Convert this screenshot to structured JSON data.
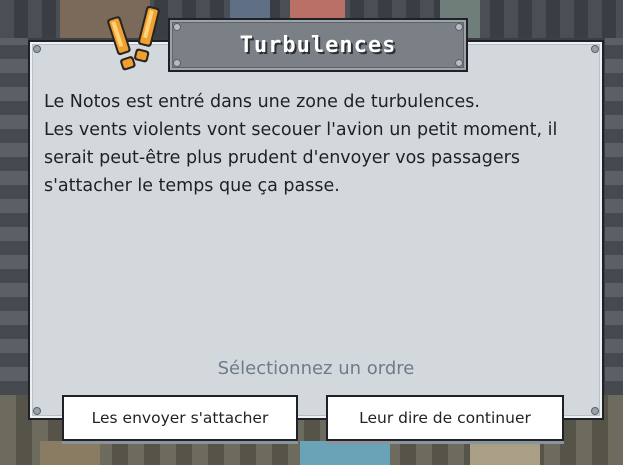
{
  "dialog": {
    "title": "Turbulences",
    "message_lines": [
      "Le Notos est entré dans une zone de turbulences.",
      "Les vents violents vont secouer l'avion un petit moment, il serait peut-être plus prudent d'envoyer vos passagers s'attacher le temps que ça passe."
    ],
    "prompt": "Sélectionnez un ordre",
    "alert_icon": "exclamation-alert-icon"
  },
  "actions": {
    "option_1": "Les envoyer s'attacher",
    "option_2": "Leur dire de continuer"
  },
  "colors": {
    "panel": "#d3d8dc",
    "title_plate": "#7b8087",
    "alert_orange": "#f0a030",
    "prompt_text": "#6f7b8c"
  }
}
